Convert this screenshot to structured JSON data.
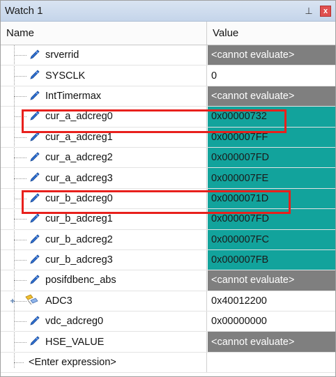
{
  "window": {
    "title": "Watch 1",
    "pin_glyph": "⊥",
    "close_glyph": "x"
  },
  "columns": {
    "name": "Name",
    "value": "Value"
  },
  "rows": [
    {
      "name": "srverrid",
      "value": "<cannot evaluate>",
      "state": "unavail",
      "icon": "variable-icon"
    },
    {
      "name": "SYSCLK",
      "value": "0",
      "state": "plain",
      "icon": "variable-icon"
    },
    {
      "name": "IntTimermax",
      "value": "<cannot evaluate>",
      "state": "unavail",
      "icon": "variable-icon"
    },
    {
      "name": "cur_a_adcreg0",
      "value": "0x00000732",
      "state": "changed",
      "icon": "variable-icon"
    },
    {
      "name": "cur_a_adcreg1",
      "value": "0x000007FF",
      "state": "changed",
      "icon": "variable-icon"
    },
    {
      "name": "cur_a_adcreg2",
      "value": "0x000007FD",
      "state": "changed",
      "icon": "variable-icon"
    },
    {
      "name": "cur_a_adcreg3",
      "value": "0x000007FE",
      "state": "changed",
      "icon": "variable-icon"
    },
    {
      "name": "cur_b_adcreg0",
      "value": "0x0000071D",
      "state": "changed",
      "icon": "variable-icon"
    },
    {
      "name": "cur_b_adcreg1",
      "value": "0x000007FD",
      "state": "changed",
      "icon": "variable-icon"
    },
    {
      "name": "cur_b_adcreg2",
      "value": "0x000007FC",
      "state": "changed",
      "icon": "variable-icon"
    },
    {
      "name": "cur_b_adcreg3",
      "value": "0x000007FB",
      "state": "changed",
      "icon": "variable-icon"
    },
    {
      "name": "posifdbenc_abs",
      "value": "<cannot evaluate>",
      "state": "unavail",
      "icon": "variable-icon"
    },
    {
      "name": "ADC3",
      "value": "0x40012200",
      "state": "plain",
      "icon": "struct-icon",
      "expandable": "+"
    },
    {
      "name": "vdc_adcreg0",
      "value": "0x00000000",
      "state": "plain",
      "icon": "variable-icon"
    },
    {
      "name": "HSE_VALUE",
      "value": "<cannot evaluate>",
      "state": "unavail",
      "icon": "variable-icon"
    }
  ],
  "enter_expression": "<Enter expression>",
  "colors": {
    "changed_value_bg": "#12a39c",
    "unavailable_value_bg": "#7f7f7f",
    "highlight_box": "#e8201c"
  }
}
